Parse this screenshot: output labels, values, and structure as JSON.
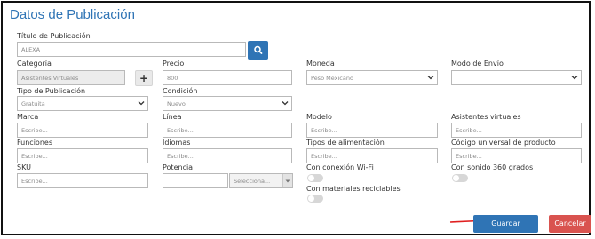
{
  "header": {
    "title": "Datos de Publicación"
  },
  "fields": {
    "titulo": {
      "label": "Título de Publicación",
      "value": "ALEXA"
    },
    "categoria": {
      "label": "Categoría",
      "value": "Asistentes Virtuales"
    },
    "precio": {
      "label": "Precio",
      "value": "800"
    },
    "moneda": {
      "label": "Moneda",
      "value": "Peso Mexicano"
    },
    "modo_envio": {
      "label": "Modo de Envío",
      "value": ""
    },
    "tipo_publicacion": {
      "label": "Tipo de Publicación",
      "value": "Gratuita"
    },
    "condicion": {
      "label": "Condición",
      "value": "Nuevo"
    },
    "marca": {
      "label": "Marca",
      "placeholder": "Escribe..."
    },
    "linea": {
      "label": "Línea",
      "placeholder": "Escribe..."
    },
    "modelo": {
      "label": "Modelo",
      "placeholder": "Escribe..."
    },
    "asistentes": {
      "label": "Asistentes virtuales",
      "placeholder": "Escribe..."
    },
    "funciones": {
      "label": "Funciones",
      "placeholder": "Escribe..."
    },
    "idiomas": {
      "label": "Idiomas",
      "placeholder": "Escribe..."
    },
    "alimentacion": {
      "label": "Tipos de alimentación",
      "placeholder": "Escribe..."
    },
    "codigo": {
      "label": "Código universal de producto",
      "placeholder": "Escribe..."
    },
    "sku": {
      "label": "SKU",
      "placeholder": "Escribe..."
    },
    "potencia": {
      "label": "Potencia",
      "value": "",
      "unit_placeholder": "Selecciona..."
    }
  },
  "toggles": {
    "wifi": {
      "label": "Con conexión Wi-Fi",
      "on": false
    },
    "sonido360": {
      "label": "Con sonido 360 grados",
      "on": false
    },
    "materiales": {
      "label": "Con materiales reciclables",
      "on": false
    }
  },
  "buttons": {
    "save": "Guardar",
    "cancel": "Cancelar"
  },
  "icons": {
    "search": "search-icon",
    "add": "plus-icon",
    "annotation": "red-arrow"
  },
  "colors": {
    "accent": "#2f74b5",
    "danger": "#d9534f",
    "arrow": "#e02020"
  }
}
